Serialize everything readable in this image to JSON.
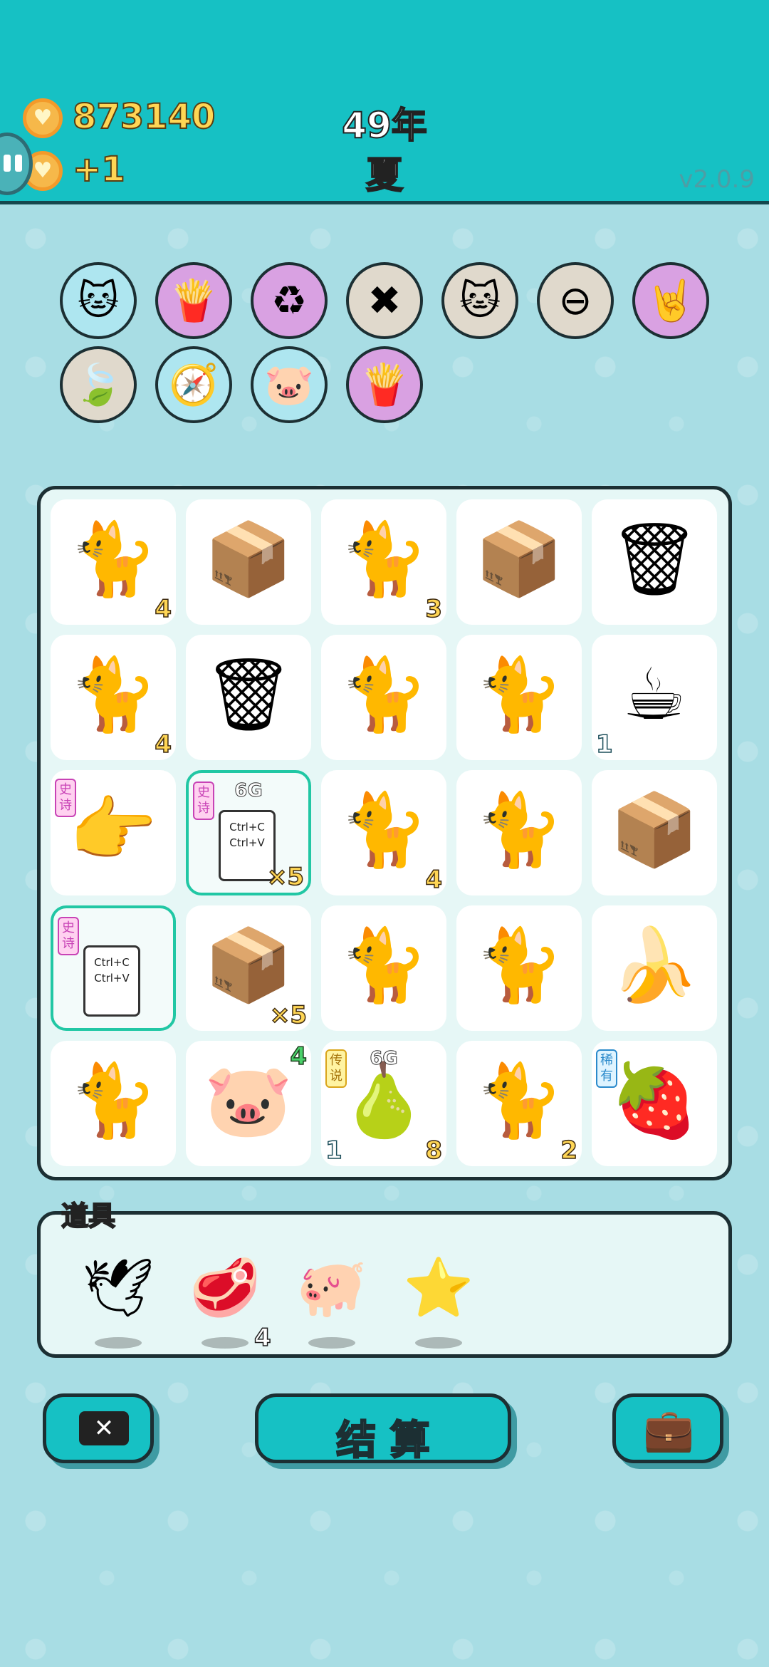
{
  "header": {
    "coins": "873140",
    "income": "+1",
    "year": "49年",
    "season": "夏",
    "version": "v2.0.9"
  },
  "buffs": [
    {
      "icon": "cat-buff-icon",
      "glyph": "🐱",
      "bg": "#aee6f0"
    },
    {
      "icon": "fries-buff-icon",
      "glyph": "🍟",
      "bg": "#d9a1e2"
    },
    {
      "icon": "recycle-icon",
      "glyph": "♻",
      "bg": "#d9a1e2"
    },
    {
      "icon": "delete-tag-icon",
      "glyph": "✖",
      "bg": "#e0d9cc"
    },
    {
      "icon": "twin-cats-icon",
      "glyph": "🐱",
      "bg": "#e0d9cc"
    },
    {
      "icon": "minus-icon",
      "glyph": "⊖",
      "bg": "#e0d9cc"
    },
    {
      "icon": "rock-hand-icon",
      "glyph": "🤘",
      "bg": "#d9a1e2"
    },
    {
      "icon": "leaf-icon",
      "glyph": "🍃",
      "bg": "#e0d9cc"
    },
    {
      "icon": "compass-icon",
      "glyph": "🧭",
      "bg": "#aee6f0"
    },
    {
      "icon": "piggy-bank-icon",
      "glyph": "🐷",
      "bg": "#aee6f0"
    },
    {
      "icon": "fries-icon",
      "glyph": "🍟",
      "bg": "#d9a1e2"
    }
  ],
  "board": [
    {
      "name": "cat",
      "glyph": "🐈",
      "num": "4",
      "pos": "br"
    },
    {
      "name": "box",
      "glyph": "📦"
    },
    {
      "name": "cat",
      "glyph": "🐈",
      "num": "3",
      "pos": "br"
    },
    {
      "name": "box",
      "glyph": "📦"
    },
    {
      "name": "garbage-bag",
      "glyph": "🗑"
    },
    {
      "name": "cat",
      "glyph": "🐈",
      "num": "4",
      "pos": "br"
    },
    {
      "name": "garbage-bag",
      "glyph": "🗑"
    },
    {
      "name": "cat",
      "glyph": "🐈"
    },
    {
      "name": "cat",
      "glyph": "🐈"
    },
    {
      "name": "coffee",
      "glyph": "☕",
      "num": "1",
      "pos": "bl"
    },
    {
      "name": "pointing-hand",
      "glyph": "👉",
      "badge": "史诗",
      "badge_class": "epic"
    },
    {
      "name": "ctrl-cv",
      "glyph": "",
      "badge": "史诗",
      "badge_class": "epic",
      "crown": "6G",
      "num": "×5",
      "pos": "br",
      "selected": true,
      "doc": "Ctrl+C Ctrl+V"
    },
    {
      "name": "cat",
      "glyph": "🐈",
      "num": "4",
      "pos": "br"
    },
    {
      "name": "cat",
      "glyph": "🐈"
    },
    {
      "name": "box",
      "glyph": "📦"
    },
    {
      "name": "ctrl-cv",
      "glyph": "",
      "badge": "史诗",
      "badge_class": "epic",
      "selected": true,
      "doc": "Ctrl+C Ctrl+V"
    },
    {
      "name": "box",
      "glyph": "📦",
      "num": "×5",
      "pos": "br"
    },
    {
      "name": "cat",
      "glyph": "🐈"
    },
    {
      "name": "cat",
      "glyph": "🐈"
    },
    {
      "name": "banana",
      "glyph": "🍌"
    },
    {
      "name": "cat",
      "glyph": "🐈"
    },
    {
      "name": "pig",
      "glyph": "🐷",
      "num": "4",
      "pos": "tr"
    },
    {
      "name": "pear",
      "glyph": "🍐",
      "badge": "传说",
      "badge_class": "legend",
      "crown": "6G",
      "num": "8",
      "pos": "br",
      "num2": "1"
    },
    {
      "name": "cat",
      "glyph": "🐈",
      "num": "2",
      "pos": "br"
    },
    {
      "name": "lychee",
      "glyph": "🍓",
      "badge": "稀有",
      "badge_class": "rare"
    }
  ],
  "items_panel": {
    "label": "道具",
    "items": [
      {
        "name": "bird",
        "glyph": "🕊"
      },
      {
        "name": "liver",
        "glyph": "🥩",
        "count": "4"
      },
      {
        "name": "piggy-bank",
        "glyph": "🐖"
      },
      {
        "name": "star",
        "glyph": "⭐"
      }
    ]
  },
  "buttons": {
    "remove": "✕",
    "settle": "结 算",
    "bag": "💼"
  }
}
